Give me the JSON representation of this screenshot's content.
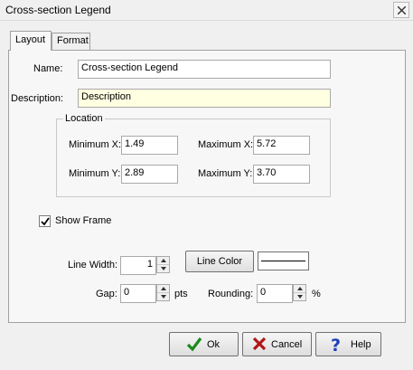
{
  "window": {
    "title": "Cross-section Legend"
  },
  "tabs": [
    {
      "label": "Layout"
    },
    {
      "label": "Format"
    }
  ],
  "form": {
    "name_label": "Name:",
    "name_value": "Cross-section Legend",
    "description_label": "Description:",
    "description_value": "Description",
    "location": {
      "group_label": "Location",
      "min_x_label": "Minimum X:",
      "min_x_value": "1.49",
      "max_x_label": "Maximum X:",
      "max_x_value": "5.72",
      "min_y_label": "Minimum Y:",
      "min_y_value": "2.89",
      "max_y_label": "Maximum Y:",
      "max_y_value": "3.70"
    },
    "show_frame_label": "Show Frame",
    "show_frame_checked": true,
    "line_width_label": "Line Width:",
    "line_width_value": "1",
    "line_color_button": "Line Color",
    "line_color_value": "#000000",
    "gap_label": "Gap:",
    "gap_value": "0",
    "gap_unit": "pts",
    "rounding_label": "Rounding:",
    "rounding_value": "0",
    "rounding_unit": "%"
  },
  "buttons": {
    "ok": "Ok",
    "cancel": "Cancel",
    "help": "Help"
  },
  "icons": {
    "close": "close-icon",
    "ok": "checkmark-icon",
    "cancel": "x-icon",
    "help": "question-icon"
  },
  "colors": {
    "ok_icon": "#1a8a1a",
    "cancel_icon": "#b01818",
    "help_icon": "#1f3fb8",
    "description_bg": "#ffffe1"
  }
}
